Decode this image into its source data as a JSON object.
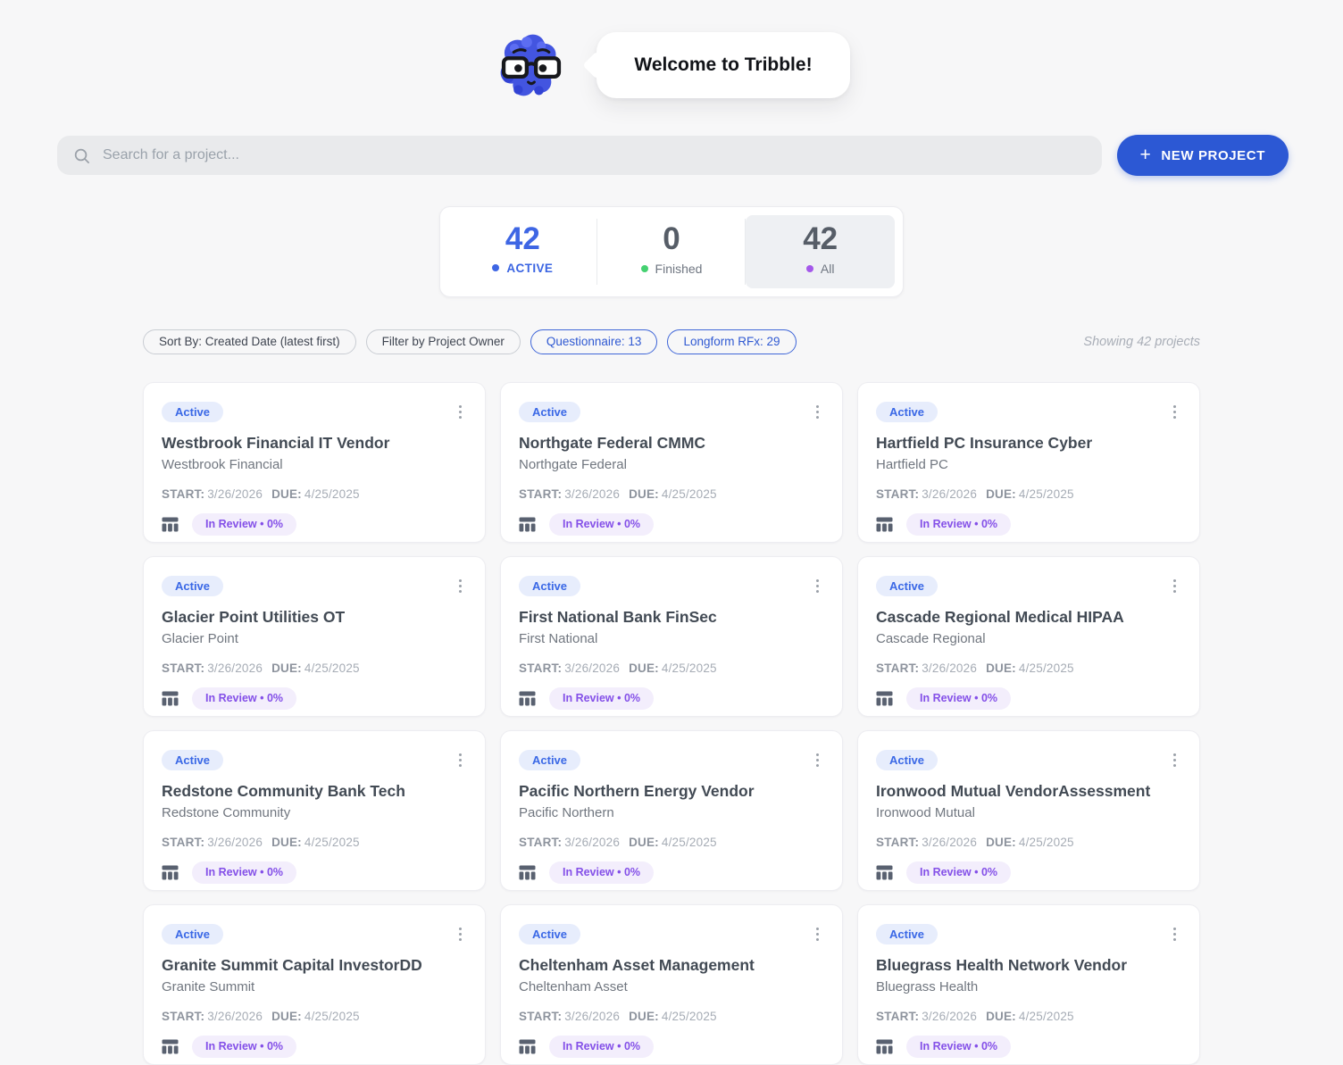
{
  "header": {
    "welcome_text": "Welcome to Tribble!"
  },
  "search": {
    "placeholder": "Search for a project..."
  },
  "toolbar": {
    "new_project_plus": "+",
    "new_project_label": "NEW PROJECT"
  },
  "stats": {
    "items": [
      {
        "value": "42",
        "label": "ACTIVE"
      },
      {
        "value": "0",
        "label": "Finished"
      },
      {
        "value": "42",
        "label": "All"
      }
    ]
  },
  "filters": {
    "chips": [
      {
        "label": "Sort By: Created Date (latest first)"
      },
      {
        "label": "Filter by Project Owner"
      },
      {
        "label": "Questionnaire: 13"
      },
      {
        "label": "Longform RFx: 29"
      }
    ],
    "showing_text": "Showing 42 projects"
  },
  "card_labels": {
    "start_label": "START:",
    "due_label": "DUE:"
  },
  "projects": [
    {
      "status": "Active",
      "title": "Westbrook Financial IT Vendor",
      "company": "Westbrook Financial",
      "start": "3/26/2026",
      "due": "4/25/2025",
      "review": "In Review • 0%"
    },
    {
      "status": "Active",
      "title": "Northgate Federal CMMC",
      "company": "Northgate Federal",
      "start": "3/26/2026",
      "due": "4/25/2025",
      "review": "In Review • 0%"
    },
    {
      "status": "Active",
      "title": "Hartfield PC Insurance Cyber",
      "company": "Hartfield PC",
      "start": "3/26/2026",
      "due": "4/25/2025",
      "review": "In Review • 0%"
    },
    {
      "status": "Active",
      "title": "Glacier Point Utilities OT",
      "company": "Glacier Point",
      "start": "3/26/2026",
      "due": "4/25/2025",
      "review": "In Review • 0%"
    },
    {
      "status": "Active",
      "title": "First National Bank FinSec",
      "company": "First National",
      "start": "3/26/2026",
      "due": "4/25/2025",
      "review": "In Review • 0%"
    },
    {
      "status": "Active",
      "title": "Cascade Regional Medical HIPAA",
      "company": "Cascade Regional",
      "start": "3/26/2026",
      "due": "4/25/2025",
      "review": "In Review • 0%"
    },
    {
      "status": "Active",
      "title": "Redstone Community Bank Tech",
      "company": "Redstone Community",
      "start": "3/26/2026",
      "due": "4/25/2025",
      "review": "In Review • 0%"
    },
    {
      "status": "Active",
      "title": "Pacific Northern Energy Vendor",
      "company": "Pacific Northern",
      "start": "3/26/2026",
      "due": "4/25/2025",
      "review": "In Review • 0%"
    },
    {
      "status": "Active",
      "title": "Ironwood Mutual VendorAssessment",
      "company": "Ironwood Mutual",
      "start": "3/26/2026",
      "due": "4/25/2025",
      "review": "In Review • 0%"
    },
    {
      "status": "Active",
      "title": "Granite Summit Capital InvestorDD",
      "company": "Granite Summit",
      "start": "3/26/2026",
      "due": "4/25/2025",
      "review": "In Review • 0%"
    },
    {
      "status": "Active",
      "title": "Cheltenham Asset Management",
      "company": "Cheltenham Asset",
      "start": "3/26/2026",
      "due": "4/25/2025",
      "review": "In Review • 0%"
    },
    {
      "status": "Active",
      "title": "Bluegrass Health Network Vendor",
      "company": "Bluegrass Health",
      "start": "3/26/2026",
      "due": "4/25/2025",
      "review": "In Review • 0%"
    }
  ],
  "colors": {
    "accent_blue": "#2c58d4",
    "stat_active_blue": "#3e66e4",
    "finished_green": "#45d171",
    "all_purple": "#a458ea",
    "badge_blue_bg": "#e7edfc",
    "badge_blue_text": "#3a68e6",
    "review_purple_bg": "#f3eefc",
    "review_purple_text": "#8450e8",
    "page_bg": "#f7f7f8"
  }
}
